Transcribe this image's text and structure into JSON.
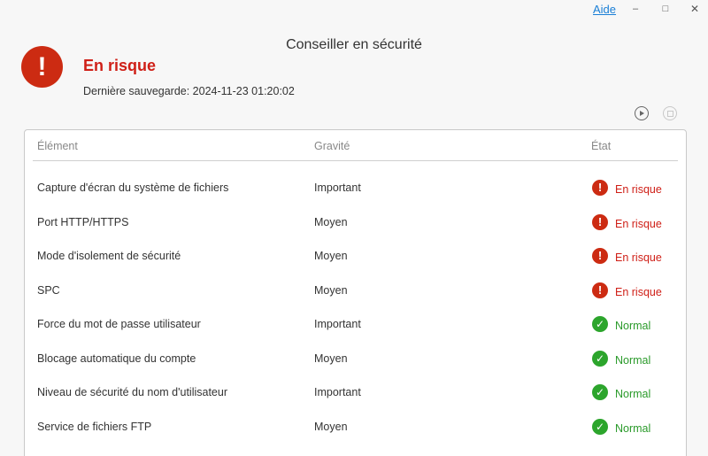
{
  "titlebar": {
    "help_label": "Aide",
    "minimize_glyph": "–",
    "maximize_glyph": "□",
    "close_glyph": "✕"
  },
  "window_title": "Conseiller en sécurité",
  "status": {
    "icon": "alert-icon",
    "icon_glyph": "!",
    "title": "En risque",
    "last_backup": "Dernière sauvegarde: 2024-11-23 01:20:02",
    "color": "#cf1f17"
  },
  "toolbar": {
    "run_icon": "play-icon",
    "stop_icon": "stop-icon"
  },
  "table": {
    "headers": [
      "Élément",
      "Gravité",
      "État"
    ],
    "rows": [
      {
        "element": "Capture d'écran du système de fichiers",
        "severity": "Important",
        "state": "En risque",
        "state_type": "risk"
      },
      {
        "element": "Port HTTP/HTTPS",
        "severity": "Moyen",
        "state": "En risque",
        "state_type": "risk"
      },
      {
        "element": "Mode d'isolement de sécurité",
        "severity": "Moyen",
        "state": "En risque",
        "state_type": "risk"
      },
      {
        "element": "SPC",
        "severity": "Moyen",
        "state": "En risque",
        "state_type": "risk"
      },
      {
        "element": "Force du mot de passe utilisateur",
        "severity": "Important",
        "state": "Normal",
        "state_type": "ok"
      },
      {
        "element": "Blocage automatique du compte",
        "severity": "Moyen",
        "state": "Normal",
        "state_type": "ok"
      },
      {
        "element": "Niveau de sécurité du nom d'utilisateur",
        "severity": "Important",
        "state": "Normal",
        "state_type": "ok"
      },
      {
        "element": "Service de fichiers FTP",
        "severity": "Moyen",
        "state": "Normal",
        "state_type": "ok"
      }
    ]
  },
  "colors": {
    "risk": "#cc2b12",
    "ok": "#2ca52c",
    "link": "#1a7fd6"
  },
  "state_glyphs": {
    "risk": "!",
    "ok": "✓"
  }
}
